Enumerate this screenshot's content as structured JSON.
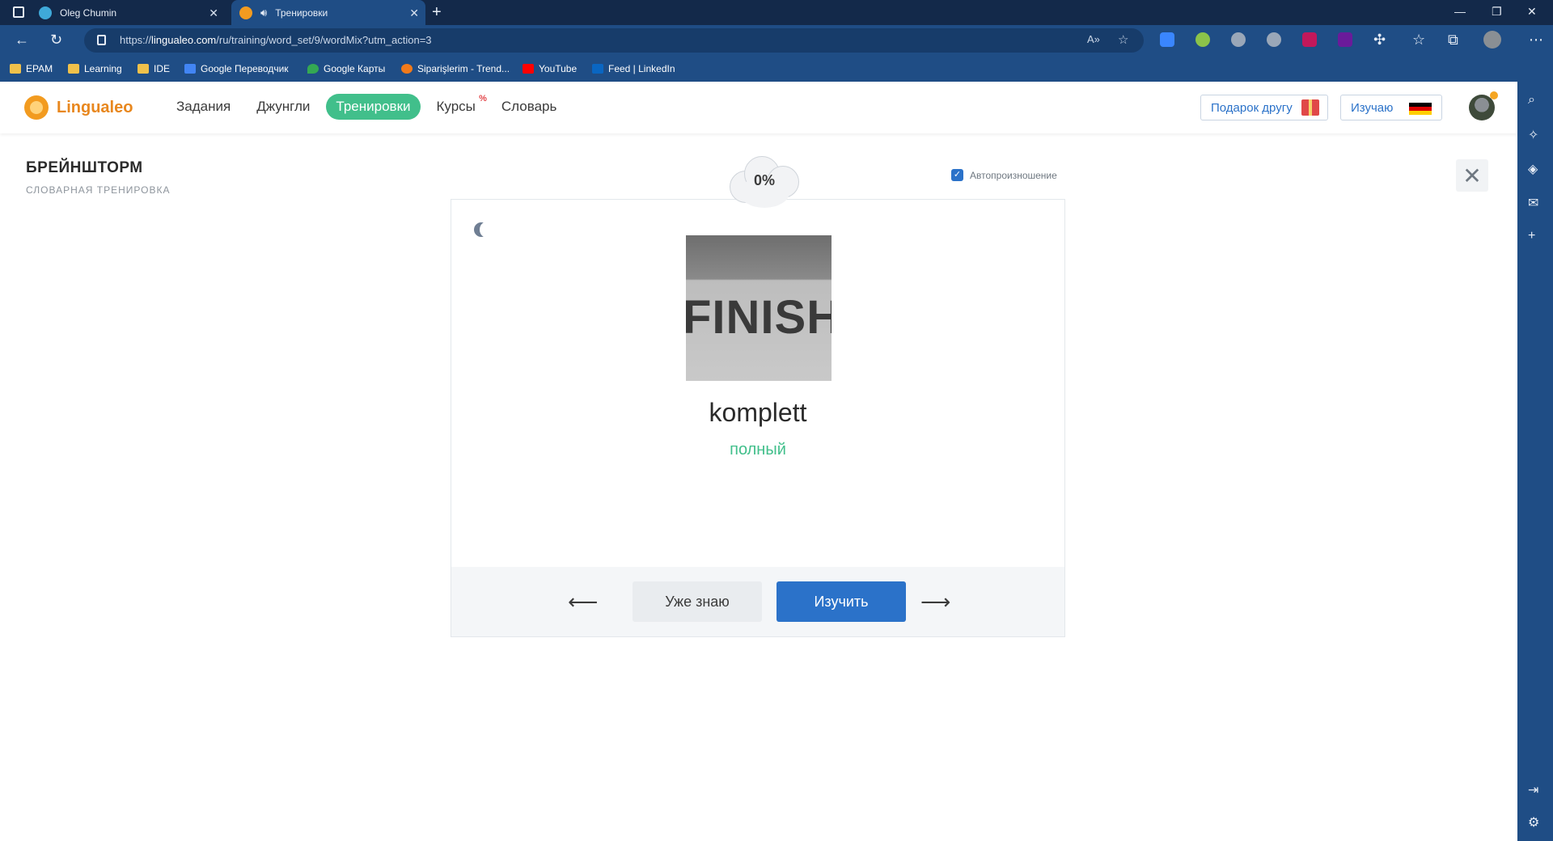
{
  "browser": {
    "tabs": [
      {
        "title": "Oleg Chumin",
        "active": false
      },
      {
        "title": "Тренировки",
        "active": true
      }
    ],
    "url_prefix": "https://",
    "url_host": "lingualeo.com",
    "url_path": "/ru/training/word_set/9/wordMix?utm_action=3",
    "bookmarks": [
      "EPAM",
      "Learning",
      "IDE",
      "Google Переводчик",
      "Google Карты",
      "Siparişlerim - Trend...",
      "YouTube",
      "Feed | LinkedIn"
    ]
  },
  "header": {
    "logo": "Lingualeo",
    "menu": [
      {
        "label": "Задания"
      },
      {
        "label": "Джунгли"
      },
      {
        "label": "Тренировки",
        "active": true
      },
      {
        "label": "Курсы",
        "badge": "%"
      },
      {
        "label": "Словарь"
      }
    ],
    "gift_label": "Подарок другу",
    "learning_label": "Изучаю"
  },
  "training": {
    "title": "БРЕЙНШТОРМ",
    "subtitle": "СЛОВАРНАЯ ТРЕНИРОВКА",
    "autoplay_label": "Автопроизношение",
    "autoplay_checked": true,
    "progress": "0%",
    "image_text": "FINISH",
    "word": "komplett",
    "translation": "полный",
    "know_label": "Уже знаю",
    "learn_label": "Изучить",
    "prev_arrow": "⟵",
    "next_arrow": "⟶"
  },
  "colors": {
    "accent_green": "#41bf8b",
    "accent_blue": "#2b72c9",
    "brand_orange": "#e8871e",
    "chrome_blue": "#1f4d85"
  }
}
